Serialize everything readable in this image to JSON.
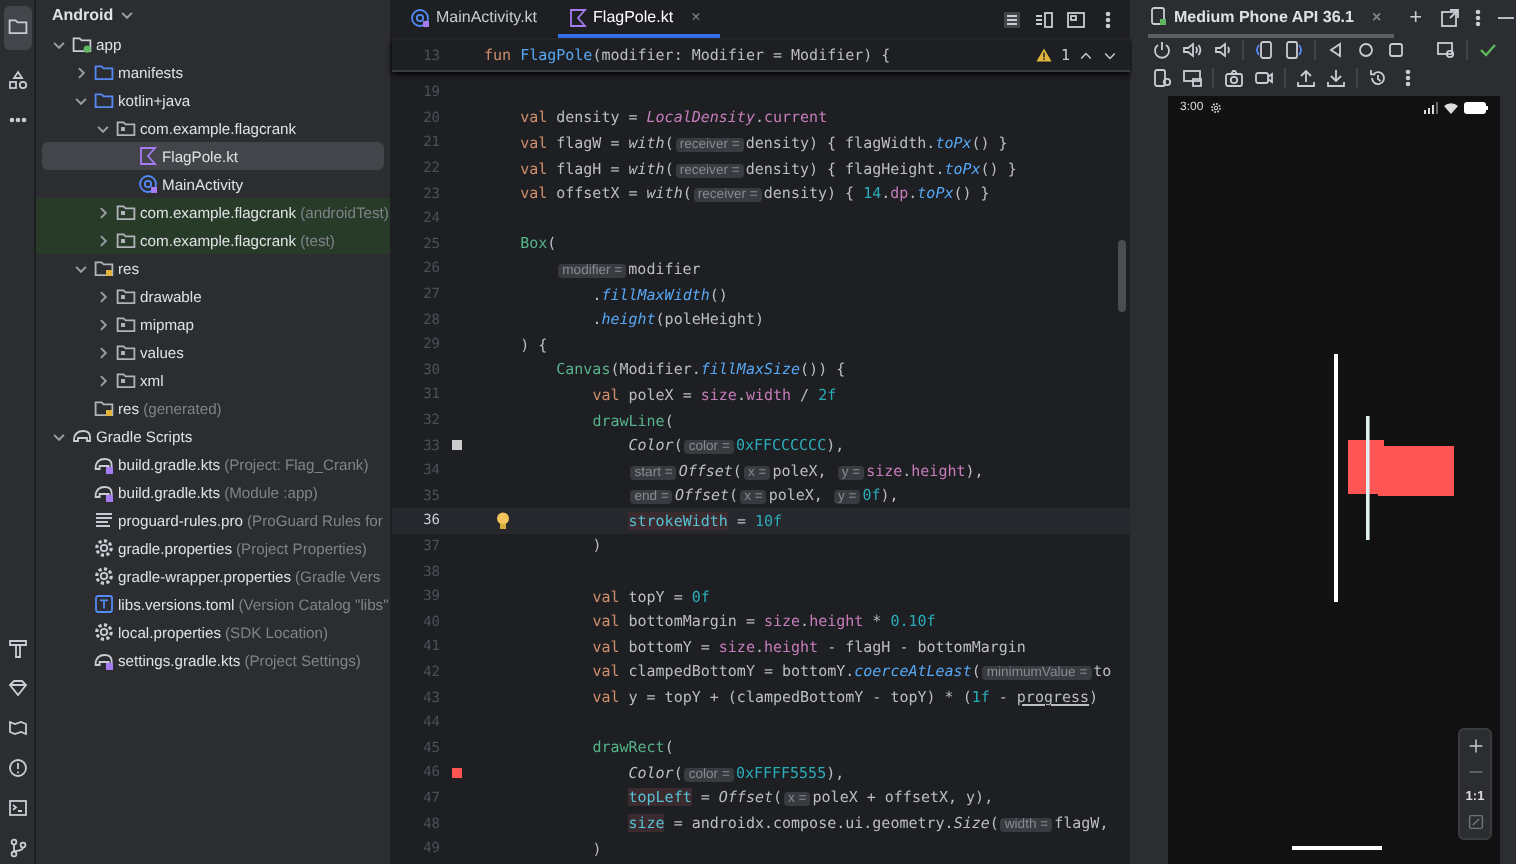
{
  "project": {
    "view": "Android",
    "tree": [
      {
        "label": "app",
        "kind": "module",
        "expanded": true,
        "children": [
          {
            "label": "manifests",
            "kind": "folder",
            "expanded": false
          },
          {
            "label": "kotlin+java",
            "kind": "folder",
            "expanded": true,
            "children": [
              {
                "label": "com.example.flagcrank",
                "kind": "package",
                "expanded": true,
                "children": [
                  {
                    "label": "FlagPole.kt",
                    "kind": "kotlin",
                    "selected": true
                  },
                  {
                    "label": "MainActivity",
                    "kind": "activity",
                    "selected": false
                  }
                ]
              },
              {
                "label": "com.example.flagcrank",
                "note": "(androidTest)",
                "kind": "package",
                "expanded": false,
                "test": true
              },
              {
                "label": "com.example.flagcrank",
                "note": "(test)",
                "kind": "package",
                "expanded": false,
                "test": true
              }
            ]
          },
          {
            "label": "res",
            "kind": "resfolder",
            "expanded": true,
            "children": [
              {
                "label": "drawable",
                "kind": "package",
                "expanded": false
              },
              {
                "label": "mipmap",
                "kind": "package",
                "expanded": false
              },
              {
                "label": "values",
                "kind": "package",
                "expanded": false
              },
              {
                "label": "xml",
                "kind": "package",
                "expanded": false
              }
            ]
          },
          {
            "label": "res",
            "note": "(generated)",
            "kind": "resfolder"
          }
        ]
      },
      {
        "label": "Gradle Scripts",
        "kind": "gradle",
        "expanded": true,
        "children": [
          {
            "label": "build.gradle.kts",
            "note": "(Project: Flag_Crank)",
            "kind": "gradlefile"
          },
          {
            "label": "build.gradle.kts",
            "note": "(Module :app)",
            "kind": "gradlefile"
          },
          {
            "label": "proguard-rules.pro",
            "note": "(ProGuard Rules for",
            "kind": "text"
          },
          {
            "label": "gradle.properties",
            "note": "(Project Properties)",
            "kind": "gear"
          },
          {
            "label": "gradle-wrapper.properties",
            "note": "(Gradle Vers",
            "kind": "gear"
          },
          {
            "label": "libs.versions.toml",
            "note": "(Version Catalog \"libs\"",
            "kind": "toml"
          },
          {
            "label": "local.properties",
            "note": "(SDK Location)",
            "kind": "gear"
          },
          {
            "label": "settings.gradle.kts",
            "note": "(Project Settings)",
            "kind": "gradlefile"
          }
        ]
      }
    ]
  },
  "editor": {
    "tabs": [
      {
        "label": "MainActivity.kt",
        "kind": "activity",
        "selected": false
      },
      {
        "label": "FlagPole.kt",
        "kind": "kotlin",
        "selected": true,
        "close": "×"
      }
    ],
    "warnings": "1",
    "sticky": {
      "n": "13",
      "segs": [
        {
          "kind": "k",
          "text": "fun "
        },
        {
          "kind": "d",
          "text": "FlagPole"
        },
        {
          "kind": "p",
          "text": "(modifier: Modifier = Modifier) {"
        }
      ]
    },
    "lines": [
      {
        "n": "19",
        "current": false
      },
      {
        "n": "20",
        "current": false,
        "segs": [
          {
            "kind": "k",
            "text": "    val"
          },
          {
            "kind": "p",
            "text": " density = "
          },
          {
            "kind": "s",
            "text": "LocalDensity"
          },
          {
            "kind": "p",
            "text": "."
          },
          {
            "kind": "v",
            "text": "current"
          }
        ]
      },
      {
        "n": "21",
        "current": false,
        "segs": [
          {
            "kind": "k",
            "text": "    val"
          },
          {
            "kind": "p",
            "text": " flagW = "
          },
          {
            "kind": "i",
            "text": "with"
          },
          {
            "kind": "p",
            "text": "("
          },
          {
            "kind": "h",
            "text": "receiver ="
          },
          {
            "kind": "p",
            "text": "density) { flagWidth."
          },
          {
            "kind": "m",
            "text": "toPx"
          },
          {
            "kind": "p",
            "text": "() }"
          }
        ]
      },
      {
        "n": "22",
        "current": false,
        "segs": [
          {
            "kind": "k",
            "text": "    val"
          },
          {
            "kind": "p",
            "text": " flagH = "
          },
          {
            "kind": "i",
            "text": "with"
          },
          {
            "kind": "p",
            "text": "("
          },
          {
            "kind": "h",
            "text": "receiver ="
          },
          {
            "kind": "p",
            "text": "density) { flagHeight."
          },
          {
            "kind": "m",
            "text": "toPx"
          },
          {
            "kind": "p",
            "text": "() }"
          }
        ]
      },
      {
        "n": "23",
        "current": false,
        "segs": [
          {
            "kind": "k",
            "text": "    val"
          },
          {
            "kind": "p",
            "text": " offsetX = "
          },
          {
            "kind": "i",
            "text": "with"
          },
          {
            "kind": "p",
            "text": "("
          },
          {
            "kind": "h",
            "text": "receiver ="
          },
          {
            "kind": "p",
            "text": "density) { "
          },
          {
            "kind": "n",
            "text": "14"
          },
          {
            "kind": "p",
            "text": "."
          },
          {
            "kind": "v",
            "text": "dp"
          },
          {
            "kind": "p",
            "text": "."
          },
          {
            "kind": "m",
            "text": "toPx"
          },
          {
            "kind": "p",
            "text": "() }"
          }
        ]
      },
      {
        "n": "24",
        "current": false
      },
      {
        "n": "25",
        "current": false,
        "segs": [
          {
            "kind": "f",
            "text": "    Box"
          },
          {
            "kind": "p",
            "text": "("
          }
        ]
      },
      {
        "n": "26",
        "current": false,
        "segs": [
          {
            "kind": "h",
            "text": "        modifier ="
          },
          {
            "kind": "p",
            "text": "modifier"
          }
        ]
      },
      {
        "n": "27",
        "current": false,
        "segs": [
          {
            "kind": "p",
            "text": "            ."
          },
          {
            "kind": "m",
            "text": "fillMaxWidth"
          },
          {
            "kind": "p",
            "text": "()"
          }
        ]
      },
      {
        "n": "28",
        "current": false,
        "segs": [
          {
            "kind": "p",
            "text": "            ."
          },
          {
            "kind": "m",
            "text": "height"
          },
          {
            "kind": "p",
            "text": "(poleHeight)"
          }
        ]
      },
      {
        "n": "29",
        "current": false,
        "segs": [
          {
            "kind": "p",
            "text": "    ) {"
          }
        ]
      },
      {
        "n": "30",
        "current": false,
        "segs": [
          {
            "kind": "f",
            "text": "        Canvas"
          },
          {
            "kind": "p",
            "text": "(Modifier."
          },
          {
            "kind": "m",
            "text": "fillMaxSize"
          },
          {
            "kind": "p",
            "text": "()) {"
          }
        ]
      },
      {
        "n": "31",
        "current": false,
        "segs": [
          {
            "kind": "k",
            "text": "            val"
          },
          {
            "kind": "p",
            "text": " poleX = "
          },
          {
            "kind": "v",
            "text": "size"
          },
          {
            "kind": "p",
            "text": "."
          },
          {
            "kind": "v",
            "text": "width"
          },
          {
            "kind": "p",
            "text": " / "
          },
          {
            "kind": "n",
            "text": "2f"
          }
        ]
      },
      {
        "n": "32",
        "current": false,
        "segs": [
          {
            "kind": "f",
            "text": "            drawLine"
          },
          {
            "kind": "p",
            "text": "("
          }
        ]
      },
      {
        "n": "33",
        "current": false,
        "gutter": {
          "kind": "swatch",
          "color": "#cccccc"
        },
        "segs": [
          {
            "kind": "i",
            "text": "                Color"
          },
          {
            "kind": "p",
            "text": "("
          },
          {
            "kind": "h",
            "text": "color ="
          },
          {
            "kind": "n",
            "text": "0xFFCCCCCC"
          },
          {
            "kind": "p",
            "text": "),"
          }
        ]
      },
      {
        "n": "34",
        "current": false,
        "segs": [
          {
            "kind": "h",
            "text": "                start ="
          },
          {
            "kind": "i",
            "text": "Offset"
          },
          {
            "kind": "p",
            "text": "("
          },
          {
            "kind": "h",
            "text": "x ="
          },
          {
            "kind": "p",
            "text": "poleX, "
          },
          {
            "kind": "h",
            "text": "y ="
          },
          {
            "kind": "v",
            "text": "size"
          },
          {
            "kind": "p",
            "text": "."
          },
          {
            "kind": "v",
            "text": "height"
          },
          {
            "kind": "p",
            "text": "),"
          }
        ]
      },
      {
        "n": "35",
        "current": false,
        "segs": [
          {
            "kind": "h",
            "text": "                end ="
          },
          {
            "kind": "i",
            "text": "Offset"
          },
          {
            "kind": "p",
            "text": "("
          },
          {
            "kind": "h",
            "text": "x ="
          },
          {
            "kind": "p",
            "text": "poleX, "
          },
          {
            "kind": "h",
            "text": "y ="
          },
          {
            "kind": "n",
            "text": "0f"
          },
          {
            "kind": "p",
            "text": "),"
          }
        ]
      },
      {
        "n": "36",
        "current": true,
        "gutter": {
          "kind": "bulb"
        },
        "segs": [
          {
            "kind": "a",
            "text": "                strokeWidth"
          },
          {
            "kind": "p",
            "text": " = "
          },
          {
            "kind": "n",
            "text": "10f"
          }
        ]
      },
      {
        "n": "37",
        "current": false,
        "segs": [
          {
            "kind": "p",
            "text": "            )"
          }
        ]
      },
      {
        "n": "38",
        "current": false
      },
      {
        "n": "39",
        "current": false,
        "segs": [
          {
            "kind": "k",
            "text": "            val"
          },
          {
            "kind": "p",
            "text": " topY = "
          },
          {
            "kind": "n",
            "text": "0f"
          }
        ]
      },
      {
        "n": "40",
        "current": false,
        "segs": [
          {
            "kind": "k",
            "text": "            val"
          },
          {
            "kind": "p",
            "text": " bottomMargin = "
          },
          {
            "kind": "v",
            "text": "size"
          },
          {
            "kind": "p",
            "text": "."
          },
          {
            "kind": "v",
            "text": "height"
          },
          {
            "kind": "p",
            "text": " * "
          },
          {
            "kind": "n",
            "text": "0.10f"
          }
        ]
      },
      {
        "n": "41",
        "current": false,
        "segs": [
          {
            "kind": "k",
            "text": "            val"
          },
          {
            "kind": "p",
            "text": " bottomY = "
          },
          {
            "kind": "v",
            "text": "size"
          },
          {
            "kind": "p",
            "text": "."
          },
          {
            "kind": "v",
            "text": "height"
          },
          {
            "kind": "p",
            "text": " - flagH - bottomMargin"
          }
        ]
      },
      {
        "n": "42",
        "current": false,
        "segs": [
          {
            "kind": "k",
            "text": "            val"
          },
          {
            "kind": "p",
            "text": " clampedBottomY = bottomY."
          },
          {
            "kind": "m",
            "text": "coerceAtLeast"
          },
          {
            "kind": "p",
            "text": "("
          },
          {
            "kind": "h",
            "text": "minimumValue ="
          },
          {
            "kind": "p",
            "text": "to"
          }
        ]
      },
      {
        "n": "43",
        "current": false,
        "segs": [
          {
            "kind": "k",
            "text": "            val"
          },
          {
            "kind": "p",
            "text": " y = topY + (clampedBottomY - topY) * ("
          },
          {
            "kind": "n",
            "text": "1f"
          },
          {
            "kind": "p",
            "text": " - "
          },
          {
            "kind": "u",
            "text": "progress"
          },
          {
            "kind": "p",
            "text": ")"
          }
        ]
      },
      {
        "n": "44",
        "current": false
      },
      {
        "n": "45",
        "current": false,
        "segs": [
          {
            "kind": "f",
            "text": "            drawRect"
          },
          {
            "kind": "p",
            "text": "("
          }
        ]
      },
      {
        "n": "46",
        "current": false,
        "gutter": {
          "kind": "swatch",
          "color": "#ff5555"
        },
        "segs": [
          {
            "kind": "i",
            "text": "                Color"
          },
          {
            "kind": "p",
            "text": "("
          },
          {
            "kind": "h",
            "text": "color ="
          },
          {
            "kind": "n",
            "text": "0xFFFF5555"
          },
          {
            "kind": "p",
            "text": "),"
          }
        ]
      },
      {
        "n": "47",
        "current": false,
        "segs": [
          {
            "kind": "a",
            "text": "                topLeft"
          },
          {
            "kind": "p",
            "text": " = "
          },
          {
            "kind": "i",
            "text": "Offset"
          },
          {
            "kind": "p",
            "text": "("
          },
          {
            "kind": "h",
            "text": "x ="
          },
          {
            "kind": "p",
            "text": "poleX + offsetX, y),"
          }
        ]
      },
      {
        "n": "48",
        "current": false,
        "segs": [
          {
            "kind": "a",
            "text": "                size"
          },
          {
            "kind": "p",
            "text": " = androidx.compose.ui.geometry."
          },
          {
            "kind": "i",
            "text": "Size"
          },
          {
            "kind": "p",
            "text": "("
          },
          {
            "kind": "h",
            "text": "width ="
          },
          {
            "kind": "p",
            "text": "flagW,"
          }
        ]
      },
      {
        "n": "49",
        "current": false,
        "segs": [
          {
            "kind": "p",
            "text": "            )"
          }
        ]
      }
    ]
  },
  "emulator": {
    "tab": "Medium Phone API 36.1",
    "close": "×",
    "add": "+",
    "time": "3:00",
    "zoom_reset": "1:1"
  }
}
